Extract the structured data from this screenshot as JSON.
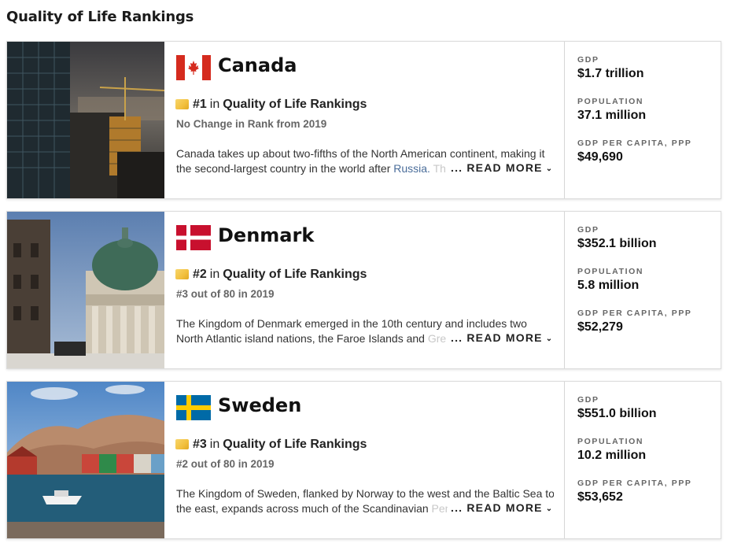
{
  "page": {
    "title": "Quality of Life Rankings"
  },
  "countries": [
    {
      "name": "Canada",
      "flag": "canada-flag",
      "rank": "#1",
      "in_text": "in",
      "ranking_list": "Quality of Life Rankings",
      "rank_change": "No Change in Rank from 2019",
      "desc_line1": "Canada takes up about two-fifths of the North American continent, making it",
      "desc_line2_a": "the second-largest country in the world after",
      "desc_line2_link": "Russia.",
      "desc_line2_fade": "Th",
      "read_more": "... READ MORE",
      "stats": [
        {
          "label": "GDP",
          "value": "$1.7 trillion"
        },
        {
          "label": "POPULATION",
          "value": "37.1 million"
        },
        {
          "label": "GDP PER CAPITA, PPP",
          "value": "$49,690"
        }
      ]
    },
    {
      "name": "Denmark",
      "flag": "denmark-flag",
      "rank": "#2",
      "in_text": "in",
      "ranking_list": "Quality of Life Rankings",
      "rank_change": "#3 out of 80 in 2019",
      "desc_line1": "The Kingdom of Denmark emerged in the 10th century and includes two",
      "desc_line2_a": "North Atlantic island nations, the Faroe Islands and",
      "desc_line2_link": "",
      "desc_line2_fade": "Gre",
      "read_more": "... READ MORE",
      "stats": [
        {
          "label": "GDP",
          "value": "$352.1 billion"
        },
        {
          "label": "POPULATION",
          "value": "5.8 million"
        },
        {
          "label": "GDP PER CAPITA, PPP",
          "value": "$52,279"
        }
      ]
    },
    {
      "name": "Sweden",
      "flag": "sweden-flag",
      "rank": "#3",
      "in_text": "in",
      "ranking_list": "Quality of Life Rankings",
      "rank_change": "#2 out of 80 in 2019",
      "desc_line1": "The Kingdom of Sweden, flanked by Norway to the west and the Baltic Sea to",
      "desc_line2_a": "the east, expands across much of the Scandinavian",
      "desc_line2_link": "",
      "desc_line2_fade": "Pen",
      "read_more": "... READ MORE",
      "stats": [
        {
          "label": "GDP",
          "value": "$551.0 billion"
        },
        {
          "label": "POPULATION",
          "value": "10.2 million"
        },
        {
          "label": "GDP PER CAPITA, PPP",
          "value": "$53,652"
        }
      ]
    }
  ],
  "colors": {
    "canada_red": "#d52b1e",
    "denmark_red": "#c8102e",
    "sweden_blue": "#006aa7",
    "sweden_yellow": "#fecc00",
    "ribbon_gold": "#f2c03d"
  }
}
